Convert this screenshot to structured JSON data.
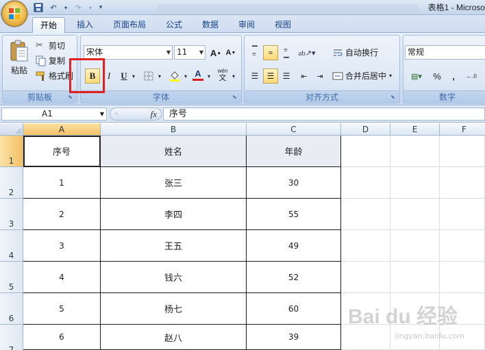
{
  "window": {
    "title": "表格1 - Microso"
  },
  "tabs": [
    "开始",
    "插入",
    "页面布局",
    "公式",
    "数据",
    "审阅",
    "视图"
  ],
  "ribbon": {
    "clipboard": {
      "label": "剪贴板",
      "paste": "粘贴",
      "cut": "剪切",
      "copy": "复制",
      "format_painter": "格式刷"
    },
    "font": {
      "label": "字体",
      "font_name": "宋体",
      "font_size": "11",
      "bold": "B",
      "italic": "I",
      "underline": "U",
      "font_color_glyph": "A",
      "phonetic_glyph": "wén"
    },
    "alignment": {
      "label": "对齐方式",
      "wrap_text": "自动换行",
      "merge_center": "合并后居中"
    },
    "number": {
      "label": "数字",
      "format": "常规",
      "percent": "%",
      "comma": ","
    }
  },
  "formula_bar": {
    "name_box": "A1",
    "fx": "fx",
    "content": "序号"
  },
  "sheet": {
    "columns": [
      "A",
      "B",
      "C",
      "D",
      "E",
      "F"
    ],
    "rows": [
      "1",
      "2",
      "3",
      "4",
      "5",
      "6",
      "7"
    ],
    "header": [
      "序号",
      "姓名",
      "年龄"
    ],
    "data": [
      [
        "1",
        "张三",
        "30"
      ],
      [
        "2",
        "李四",
        "55"
      ],
      [
        "3",
        "王五",
        "49"
      ],
      [
        "4",
        "钱六",
        "52"
      ],
      [
        "5",
        "杨七",
        "60"
      ],
      [
        "6",
        "赵八",
        "39"
      ]
    ]
  },
  "watermark": {
    "text": "Bai du 经验",
    "sub": "jingyan.baidu.com"
  }
}
